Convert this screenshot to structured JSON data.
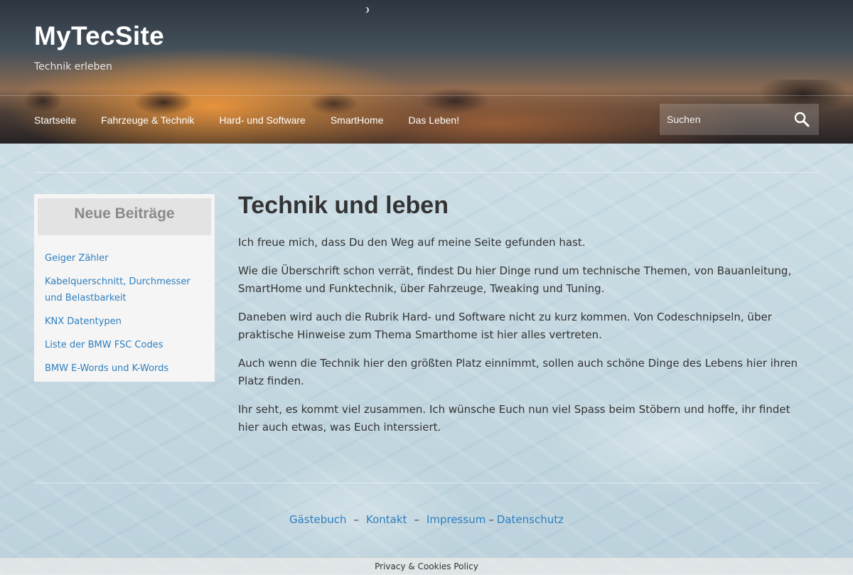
{
  "site": {
    "title": "MyTecSite",
    "tagline": "Technik erleben"
  },
  "nav": {
    "items": [
      "Startseite",
      "Fahrzeuge & Technik",
      "Hard- und Software",
      "SmartHome",
      "Das Leben!"
    ]
  },
  "search": {
    "placeholder": "Suchen",
    "icon": "search-icon"
  },
  "sidebar": {
    "heading": "Neue Beiträge",
    "posts": [
      "Geiger Zähler",
      "Kabelquerschnitt, Durchmesser und Belastbarkeit",
      "KNX Datentypen",
      "Liste der BMW FSC Codes",
      "BMW E-Words und K-Words"
    ]
  },
  "main": {
    "title": "Technik und leben",
    "paragraphs": [
      "Ich freue mich, dass Du den Weg auf meine Seite gefunden hast.",
      "Wie die Überschrift schon verrät, findest Du hier Dinge rund um technische Themen, von Bauanleitung, SmartHome und Funktechnik, über Fahrzeuge, Tweaking und Tuning.",
      "Daneben wird auch die Rubrik Hard- und Software nicht zu kurz kommen. Von Codeschnipseln, über praktische Hinweise zum Thema Smarthome ist hier alles vertreten.",
      "Auch wenn die Technik hier den größten Platz einnimmt, sollen auch schöne Dinge des Lebens hier ihren Platz finden.",
      "Ihr seht, es kommt viel zusammen. Ich wünsche Euch nun viel Spass beim Stöbern und hoffe, ihr findet hier auch etwas, was Euch interssiert."
    ]
  },
  "footer": {
    "links": [
      "Gästebuch",
      "Kontakt",
      "Impressum",
      "Datenschutz"
    ],
    "separator": "–",
    "policy": "Privacy & Cookies Policy"
  },
  "colors": {
    "link": "#2e7fbf",
    "text": "#333333",
    "widget_heading": "#8a8a8a"
  }
}
